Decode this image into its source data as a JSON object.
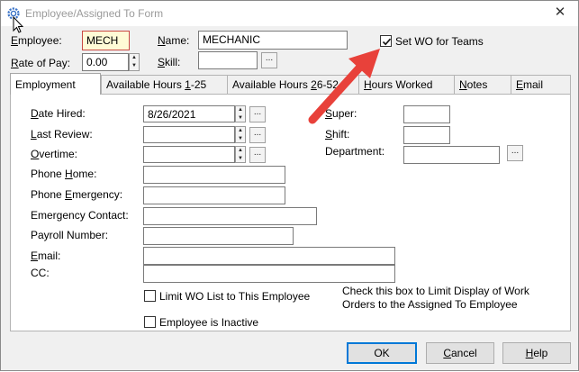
{
  "window": {
    "title": "Employee/Assigned To Form",
    "close_glyph": "✕"
  },
  "header": {
    "employee_label": "Employee:",
    "employee_value": "MECH",
    "name_label": "Name:",
    "name_value": "MECHANIC",
    "rate_label": "Rate of Pay:",
    "rate_value": "0.00",
    "skill_label": "Skill:",
    "skill_value": "",
    "set_wo_label": "Set WO for Teams",
    "set_wo_checked": true
  },
  "tabs": [
    {
      "label": "Employment",
      "active": true
    },
    {
      "label": "Available Hours 1-25",
      "active": false
    },
    {
      "label": "Available Hours 26-52",
      "active": false
    },
    {
      "label": "Hours Worked",
      "active": false
    },
    {
      "label": "Notes",
      "active": false
    },
    {
      "label": "Email",
      "active": false
    }
  ],
  "employment": {
    "date_hired_label": "Date Hired:",
    "date_hired_value": "8/26/2021",
    "last_review_label": "Last Review:",
    "overtime_label": "Overtime:",
    "phone_home_label": "Phone Home:",
    "phone_emergency_label": "Phone Emergency:",
    "emergency_contact_label": "Emergency Contact:",
    "payroll_label": "Payroll Number:",
    "email_label": "Email:",
    "cc_label": "CC:",
    "super_label": "Super:",
    "shift_label": "Shift:",
    "department_label": "Department:",
    "limit_wo_label": "Limit WO List to This Employee",
    "inactive_label": "Employee is Inactive",
    "hint_line1": "Check this box to Limit Display of Work",
    "hint_line2": "Orders to the Assigned To Employee"
  },
  "buttons": {
    "ok": "OK",
    "cancel": "Cancel",
    "help": "Help",
    "ellipsis": "...",
    "spin_up": "▲",
    "spin_down": "▼"
  },
  "colors": {
    "annotation_arrow": "#e8413a",
    "employee_field_bg": "#fffbd6",
    "employee_field_border": "#c94a44"
  }
}
